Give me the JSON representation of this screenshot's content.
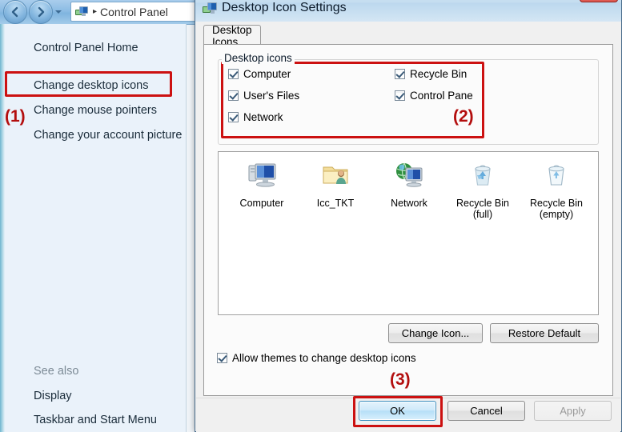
{
  "control_panel": {
    "window_title": "Control Panel",
    "address_text": "Control Panel",
    "address_separator": "▸",
    "nav_back_icon": "back-arrow-icon",
    "nav_forward_icon": "forward-arrow-icon",
    "nav_dropdown_icon": "chevron-down-icon",
    "sidebar": {
      "home_label": "Control Panel Home",
      "items": [
        {
          "label": "Change desktop icons",
          "highlighted": true
        },
        {
          "label": "Change mouse pointers",
          "highlighted": false
        },
        {
          "label": "Change your account picture",
          "highlighted": false
        }
      ],
      "see_also_label": "See also",
      "see_also_items": [
        {
          "label": "Display"
        },
        {
          "label": "Taskbar and Start Menu"
        }
      ]
    }
  },
  "dialog": {
    "title": "Desktop Icon Settings",
    "title_icon": "desktop-icon-settings-icon",
    "close_label": "✕",
    "tab": {
      "label": "Desktop Icons",
      "active": true
    },
    "group": {
      "label": "Desktop icons",
      "checkboxes": [
        {
          "label": "Computer",
          "checked": true,
          "col": 0,
          "row": 0
        },
        {
          "label": "User's Files",
          "checked": true,
          "col": 0,
          "row": 1
        },
        {
          "label": "Network",
          "checked": true,
          "col": 0,
          "row": 2
        },
        {
          "label": "Recycle Bin",
          "checked": true,
          "col": 1,
          "row": 0
        },
        {
          "label": "Control Pane",
          "checked": true,
          "col": 1,
          "row": 1
        }
      ]
    },
    "preview": {
      "items": [
        {
          "label": "Computer",
          "icon": "computer-icon"
        },
        {
          "label": "Icc_TKT",
          "icon": "user-folder-icon"
        },
        {
          "label": "Network",
          "icon": "network-icon"
        },
        {
          "label": "Recycle Bin\n(full)",
          "icon": "recycle-bin-full-icon"
        },
        {
          "label": "Recycle Bin\n(empty)",
          "icon": "recycle-bin-empty-icon"
        }
      ]
    },
    "change_icon_label": "Change Icon...",
    "restore_default_label": "Restore Default",
    "allow_themes": {
      "label": "Allow themes to change desktop icons",
      "checked": true
    },
    "ok_label": "OK",
    "cancel_label": "Cancel",
    "apply_label": "Apply",
    "apply_enabled": false
  },
  "annotations": {
    "step1": "(1)",
    "step2": "(2)",
    "step3": "(3)",
    "color": "#cc1111"
  }
}
